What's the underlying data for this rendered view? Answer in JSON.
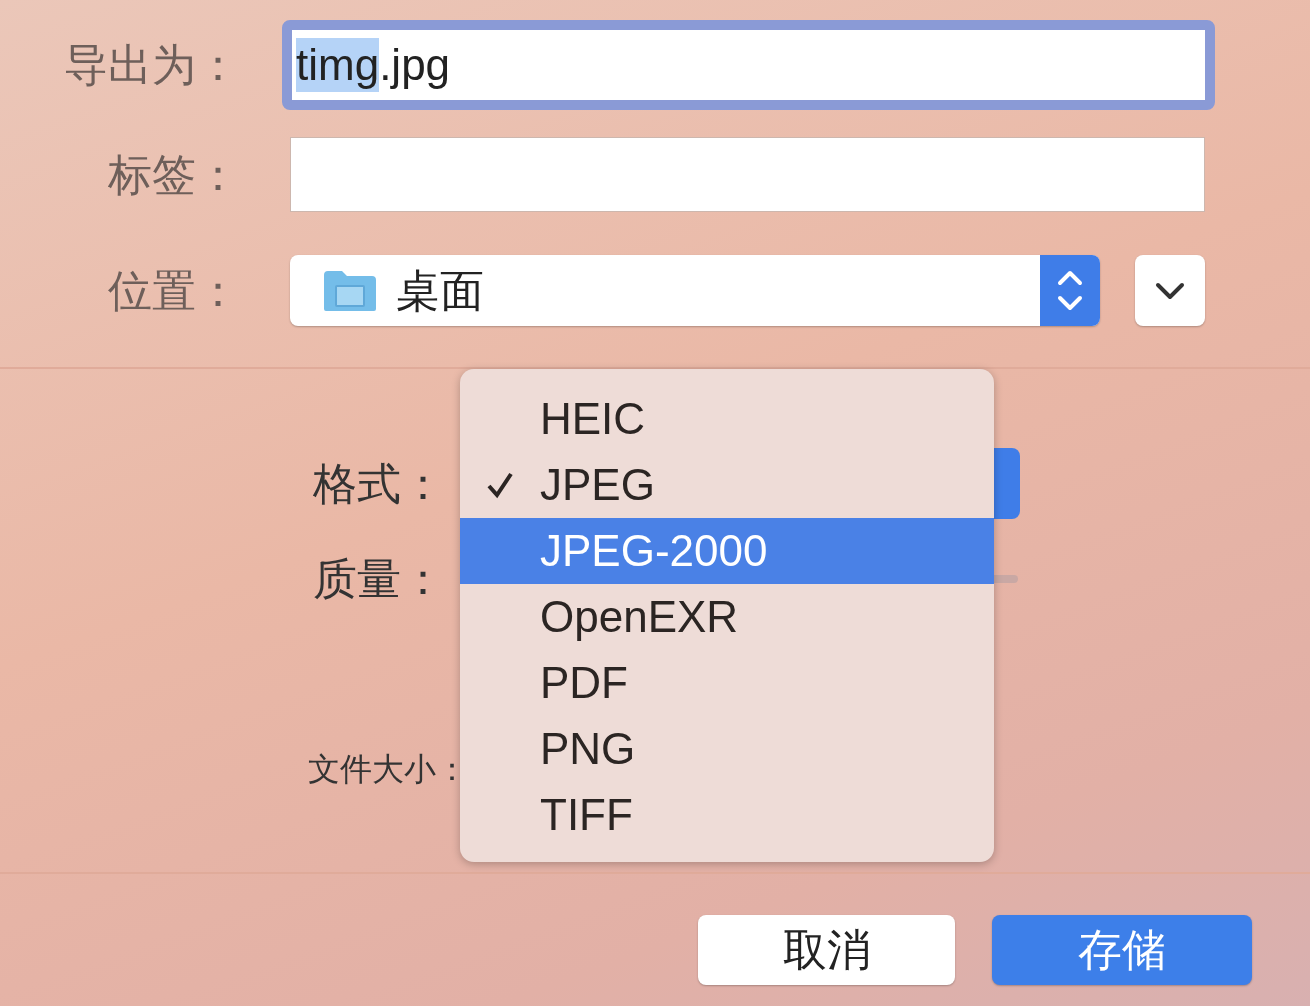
{
  "export_as": {
    "label": "导出为：",
    "focused": true,
    "value_parts": [
      {
        "text": "timg",
        "selected": true
      },
      {
        "text": ".jpg",
        "selected": false
      }
    ]
  },
  "tags": {
    "label": "标签：",
    "focused": false
  },
  "location": {
    "label": "位置：",
    "value": "桌面"
  },
  "format": {
    "label": "格式："
  },
  "quality": {
    "label": "质量："
  },
  "file_size": {
    "label": "文件大小："
  },
  "format_menu": [
    {
      "label": "HEIC",
      "checked": false,
      "selected": false
    },
    {
      "label": "JPEG",
      "checked": true,
      "selected": false
    },
    {
      "label": "JPEG-2000",
      "checked": false,
      "selected": true
    },
    {
      "label": "OpenEXR",
      "checked": false,
      "selected": false
    },
    {
      "label": "PDF",
      "checked": false,
      "selected": false
    },
    {
      "label": "PNG",
      "checked": false,
      "selected": false
    },
    {
      "label": "TIFF",
      "checked": false,
      "selected": false
    }
  ],
  "buttons": [
    {
      "label": "取消",
      "kind": "default"
    },
    {
      "label": "存储",
      "kind": "primary"
    }
  ]
}
